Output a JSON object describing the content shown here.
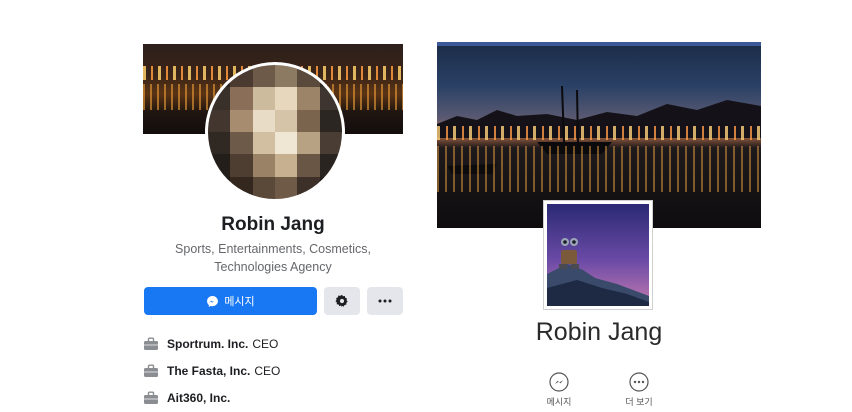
{
  "left_profile": {
    "name": "Robin Jang",
    "category": "Sports, Entertainments, Cosmetics, Technologies Agency",
    "message_button_label": "메시지",
    "info_items": [
      {
        "icon": "briefcase-icon",
        "title": "Sportrum. Inc.",
        "suffix": "CEO"
      },
      {
        "icon": "briefcase-icon",
        "title": "The Fasta, Inc.",
        "suffix": "CEO"
      },
      {
        "icon": "briefcase-icon",
        "title": "Ait360, Inc.",
        "suffix": ""
      }
    ],
    "accent_color": "#1877f2",
    "icons": [
      "messenger-icon",
      "gear-icon",
      "more-icon"
    ]
  },
  "right_profile": {
    "name": "Robin Jang",
    "actions": [
      {
        "icon": "messenger-icon",
        "label": "메시지"
      },
      {
        "icon": "more-icon",
        "label": "더 보기"
      }
    ],
    "accent_color": "#3b5998"
  }
}
